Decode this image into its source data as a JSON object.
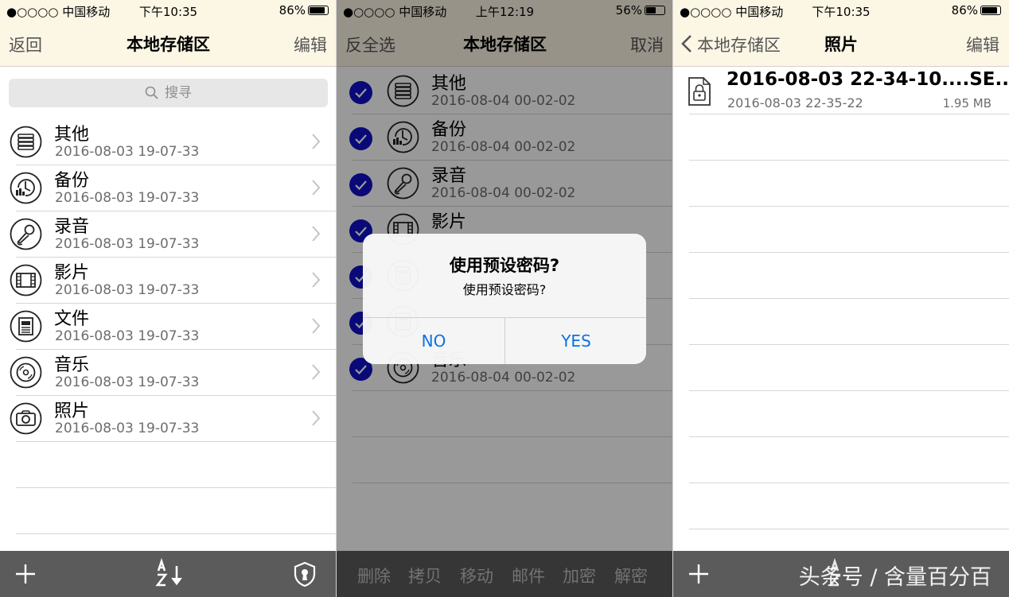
{
  "status_left": {
    "carrier": "●○○○○ 中国移动",
    "time": "下午10:35",
    "battery": "86%",
    "battery_fill": 0.86
  },
  "status_mid": {
    "carrier": "●○○○○ 中国移动",
    "time": "上午12:19",
    "battery": "56%",
    "battery_fill": 0.56
  },
  "status_right": {
    "carrier": "●○○○○ 中国移动",
    "time": "下午10:35",
    "battery": "86%",
    "battery_fill": 0.86
  },
  "panel1": {
    "nav": {
      "left": "返回",
      "title": "本地存储区",
      "right": "编辑"
    },
    "search_placeholder": "搜寻",
    "items": [
      {
        "name": "其他",
        "date": "2016-08-03 19-07-33",
        "icon": "books-icon"
      },
      {
        "name": "备份",
        "date": "2016-08-03 19-07-33",
        "icon": "backup-icon"
      },
      {
        "name": "录音",
        "date": "2016-08-03 19-07-33",
        "icon": "microphone-icon"
      },
      {
        "name": "影片",
        "date": "2016-08-03 19-07-33",
        "icon": "film-icon"
      },
      {
        "name": "文件",
        "date": "2016-08-03 19-07-33",
        "icon": "document-icon"
      },
      {
        "name": "音乐",
        "date": "2016-08-03 19-07-33",
        "icon": "disc-icon"
      },
      {
        "name": "照片",
        "date": "2016-08-03 19-07-33",
        "icon": "camera-icon"
      }
    ],
    "toolbar": {
      "add": "plus-icon",
      "sort": "sort-az-icon",
      "lock": "keyhole-icon"
    }
  },
  "panel2": {
    "nav": {
      "left": "反全选",
      "title": "本地存储区",
      "right": "取消"
    },
    "items": [
      {
        "name": "其他",
        "date": "2016-08-04 00-02-02",
        "icon": "books-icon"
      },
      {
        "name": "备份",
        "date": "2016-08-04 00-02-02",
        "icon": "backup-icon"
      },
      {
        "name": "录音",
        "date": "2016-08-04 00-02-02",
        "icon": "microphone-icon"
      },
      {
        "name": "影片",
        "date": "",
        "icon": "film-icon"
      },
      {
        "name": "",
        "date": "",
        "icon": "document-icon"
      },
      {
        "name": "",
        "date": "",
        "icon": "document-icon"
      },
      {
        "name": "音乐",
        "date": "2016-08-04 00-02-02",
        "icon": "disc-icon"
      }
    ],
    "alert": {
      "title": "使用预设密码?",
      "message": "使用预设密码?",
      "no": "NO",
      "yes": "YES"
    },
    "toolbar": [
      "删除",
      "拷贝",
      "移动",
      "邮件",
      "加密",
      "解密"
    ]
  },
  "panel3": {
    "nav": {
      "back": "本地存储区",
      "title": "照片",
      "right": "编辑"
    },
    "file": {
      "name": "2016-08-03 22-34-10....SE...",
      "date": "2016-08-03 22-35-22",
      "size": "1.95 MB",
      "icon": "locked-file-icon"
    },
    "toolbar": {
      "add": "plus-icon"
    },
    "watermark": "头条号 / 含量百分百"
  },
  "colors": {
    "nav_bg": "#fcf6e4",
    "toolbar_bg": "#5b5b5b",
    "check": "#1010c8",
    "alert_button": "#0a72e0"
  }
}
